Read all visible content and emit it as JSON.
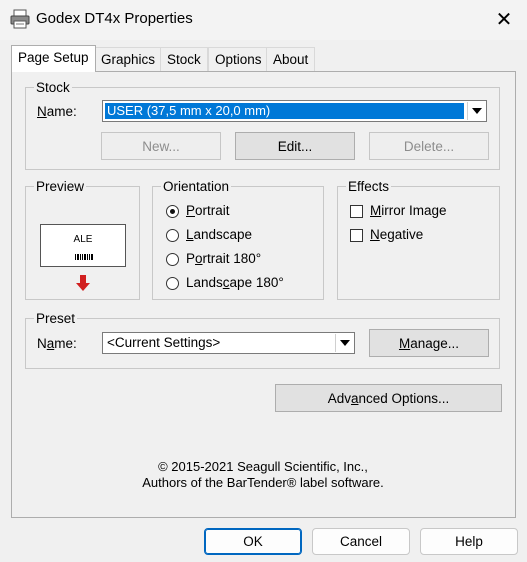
{
  "window": {
    "title": "Godex DT4x Properties",
    "close_glyph": "✕"
  },
  "tabs": [
    "Page Setup",
    "Graphics",
    "Stock",
    "Options",
    "About"
  ],
  "stock": {
    "legend": "Stock",
    "name_label_pre": "",
    "name_label_ul": "N",
    "name_label_post": "ame:",
    "value": "USER (37,5 mm x 20,0 mm)",
    "new_label": "New...",
    "edit_label": "Edit...",
    "delete_label": "Delete..."
  },
  "preview": {
    "legend": "Preview",
    "sample_text": "ALE",
    "arrow_color": "#d11f1f"
  },
  "orientation": {
    "legend": "Orientation",
    "options": [
      "Portrait",
      "Landscape",
      "Portrait 180°",
      "Landscape 180°"
    ],
    "selected": "Portrait"
  },
  "effects": {
    "legend": "Effects",
    "options": [
      "Mirror Image",
      "Negative"
    ]
  },
  "preset": {
    "legend": "Preset",
    "name_label": "Name:",
    "value": "<Current Settings>",
    "manage_label": "Manage..."
  },
  "advanced_label": "Advanced Options...",
  "copyright": {
    "line1": "© 2015-2021 Seagull Scientific, Inc.,",
    "line2": "Authors of the BarTender® label software."
  },
  "footer": {
    "ok": "OK",
    "cancel": "Cancel",
    "help": "Help"
  },
  "colors": {
    "accent": "#0078d7",
    "window_bg": "#f0f0f0"
  }
}
